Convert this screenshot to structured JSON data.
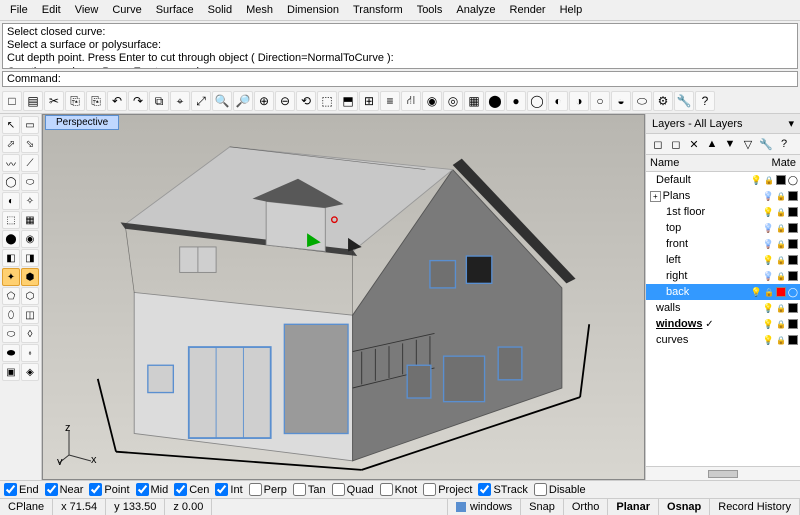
{
  "menu": [
    "File",
    "Edit",
    "View",
    "Curve",
    "Surface",
    "Solid",
    "Mesh",
    "Dimension",
    "Transform",
    "Tools",
    "Analyze",
    "Render",
    "Help"
  ],
  "command_log": [
    "Select closed curve:",
    "Select a surface or polysurface:",
    "Cut depth point. Press Enter to cut through object ( Direction=NormalToCurve ):",
    "Creating meshes... Press Esc to cancel"
  ],
  "command_prompt": "Command:",
  "command_value": "",
  "viewport_tab": "Perspective",
  "axis_labels": {
    "x": "x",
    "y": "y",
    "z": "z"
  },
  "layers_panel": {
    "title": "Layers - All Layers",
    "cols": {
      "name": "Name",
      "mat": "Mate"
    },
    "items": [
      {
        "name": "Default",
        "indent": 8,
        "light": "#ffd040",
        "lock": true,
        "color": "#000000",
        "mat": "circle"
      },
      {
        "name": "Plans",
        "indent": 2,
        "expand": "+",
        "light": "#64b4ff",
        "lock": true,
        "color": "#000000"
      },
      {
        "name": "1st floor",
        "indent": 18,
        "light": "#ffd040",
        "lock": true,
        "color": "#000000"
      },
      {
        "name": "top",
        "indent": 18,
        "light": "#64b4ff",
        "lock": true,
        "color": "#000000"
      },
      {
        "name": "front",
        "indent": 18,
        "light": "#64b4ff",
        "lock": true,
        "color": "#000000"
      },
      {
        "name": "left",
        "indent": 18,
        "light": "#ffd040",
        "lock": true,
        "color": "#000000"
      },
      {
        "name": "right",
        "indent": 18,
        "light": "#64b4ff",
        "lock": true,
        "color": "#000000"
      },
      {
        "name": "back",
        "indent": 18,
        "light": "#ffd040",
        "lock": true,
        "color": "#ff0000",
        "mat": "circle",
        "sel": true
      },
      {
        "name": "walls",
        "indent": 8,
        "light": "#ffd040",
        "lock": true,
        "color": "#000000"
      },
      {
        "name": "windows",
        "indent": 8,
        "check": true,
        "light": "#ffd040",
        "lock": true,
        "color": "#000000",
        "underline": true
      },
      {
        "name": "curves",
        "indent": 8,
        "light": "#ffd040",
        "lock": true,
        "color": "#000000"
      }
    ]
  },
  "osnap": [
    {
      "label": "End",
      "checked": true
    },
    {
      "label": "Near",
      "checked": true
    },
    {
      "label": "Point",
      "checked": true
    },
    {
      "label": "Mid",
      "checked": true
    },
    {
      "label": "Cen",
      "checked": true
    },
    {
      "label": "Int",
      "checked": true
    },
    {
      "label": "Perp",
      "checked": false
    },
    {
      "label": "Tan",
      "checked": false
    },
    {
      "label": "Quad",
      "checked": false
    },
    {
      "label": "Knot",
      "checked": false
    },
    {
      "label": "Project",
      "checked": false
    },
    {
      "label": "STrack",
      "checked": true
    },
    {
      "label": "Disable",
      "checked": false
    }
  ],
  "status": {
    "cplane": "CPlane",
    "x": "x 71.54",
    "y": "y 133.50",
    "z": "z 0.00",
    "layer": "windows",
    "layer_color": "#5a8fd0",
    "buttons": [
      "Snap",
      "Ortho",
      "Planar",
      "Osnap",
      "Record History"
    ],
    "bold": [
      "Planar",
      "Osnap"
    ]
  },
  "top_tool_icons": [
    "□",
    "▤",
    "✂",
    "⎘",
    "⎘",
    "↶",
    "↷",
    "⧉",
    "⌖",
    "⤢",
    "🔍",
    "🔎",
    "⊕",
    "⊖",
    "⟲",
    "⬚",
    "⬒",
    "⊞",
    "≡",
    "⛙",
    "◉",
    "◎",
    "▦",
    "⬤",
    "●",
    "◯",
    "◐",
    "◑",
    "○",
    "◒",
    "⬭",
    "⚙",
    "🔧",
    "?"
  ],
  "left_tools": [
    [
      "↖",
      "▭"
    ],
    [
      "⬀",
      "⬂"
    ],
    [
      "〰",
      "⟋"
    ],
    [
      "◯",
      "⬭"
    ],
    [
      "◐",
      "✧"
    ],
    [
      "⬚",
      "▦"
    ],
    [
      "⬤",
      "◉"
    ],
    [
      "◧",
      "◨"
    ],
    [
      "✦",
      "⬢"
    ],
    [
      "⬠",
      "⬡"
    ],
    [
      "⬯",
      "◫"
    ],
    [
      "⬭",
      "◊"
    ],
    [
      "⬬",
      "⬫"
    ],
    [
      "▣",
      "◈"
    ]
  ],
  "left_sel": 8
}
